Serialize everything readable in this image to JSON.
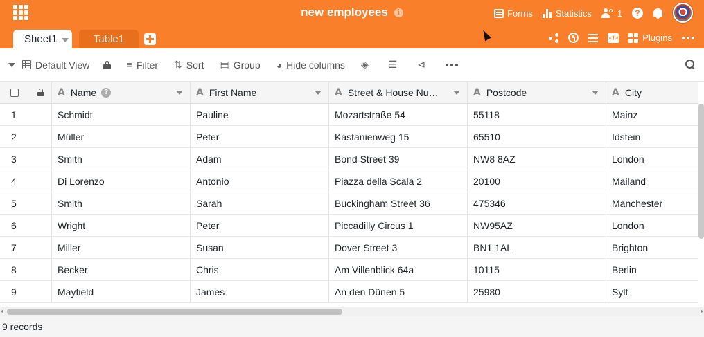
{
  "header": {
    "title": "new employees",
    "actions": {
      "forms": "Forms",
      "statistics": "Statistics",
      "collaborators_count": "1"
    },
    "tabs": [
      {
        "label": "Sheet1",
        "active": true
      },
      {
        "label": "Table1",
        "active": false
      }
    ],
    "tab_tools": {
      "plugins": "Plugins"
    },
    "colors": {
      "accent": "#f97f2b",
      "accent_dark": "#e86f1c"
    }
  },
  "toolbar": {
    "view_label": "Default View",
    "filter": "Filter",
    "sort": "Sort",
    "group": "Group",
    "hide_columns": "Hide columns"
  },
  "table": {
    "columns": [
      "Name",
      "First Name",
      "Street & House Nu…",
      "Postcode",
      "City"
    ],
    "rows": [
      {
        "num": "1",
        "name": "Schmidt",
        "first": "Pauline",
        "street": "Mozartstraße 54",
        "postcode": "55118",
        "city": "Mainz"
      },
      {
        "num": "2",
        "name": "Müller",
        "first": "Peter",
        "street": "Kastanienweg 15",
        "postcode": "65510",
        "city": "Idstein"
      },
      {
        "num": "3",
        "name": "Smith",
        "first": "Adam",
        "street": "Bond Street 39",
        "postcode": "NW8 8AZ",
        "city": "London"
      },
      {
        "num": "4",
        "name": "Di Lorenzo",
        "first": "Antonio",
        "street": "Piazza della Scala 2",
        "postcode": "20100",
        "city": "Mailand"
      },
      {
        "num": "5",
        "name": "Smith",
        "first": "Sarah",
        "street": "Buckingham Street 36",
        "postcode": "475346",
        "city": "Manchester"
      },
      {
        "num": "6",
        "name": "Wright",
        "first": "Peter",
        "street": "Piccadilly Circus 1",
        "postcode": "NW95AZ",
        "city": "London"
      },
      {
        "num": "7",
        "name": "Miller",
        "first": "Susan",
        "street": "Dover Street 3",
        "postcode": "BN1 1AL",
        "city": "Brighton"
      },
      {
        "num": "8",
        "name": "Becker",
        "first": "Chris",
        "street": "Am Villenblick 64a",
        "postcode": "10115",
        "city": "Berlin"
      },
      {
        "num": "9",
        "name": "Mayfield",
        "first": "James",
        "street": "An den Dünen 5",
        "postcode": "25980",
        "city": "Sylt"
      }
    ]
  },
  "footer": {
    "records": "9 records"
  }
}
